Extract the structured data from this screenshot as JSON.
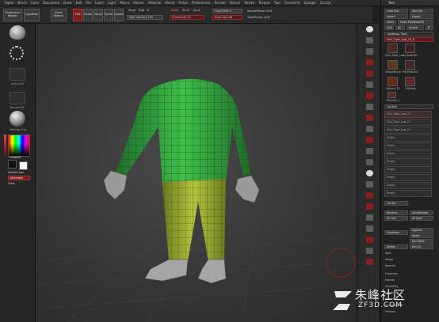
{
  "menu": [
    "Alpha",
    "Brush",
    "Color",
    "Document",
    "Draw",
    "Edit",
    "File",
    "Layer",
    "Light",
    "Macro",
    "Marker",
    "Material",
    "Movie",
    "Picker",
    "Preferences",
    "Render",
    "Stencil",
    "Stroke",
    "Texture",
    "Tool",
    "Transform",
    "Zplugin",
    "Zscript"
  ],
  "top": {
    "projection": "Projection Master",
    "lightbox": "LightBox",
    "quicksketch": "Quick Sketch",
    "edit": "Edit",
    "draw": "Draw",
    "move": "Move",
    "scale": "Scale",
    "rotate": "Rotate",
    "mrgb": "Mrgb",
    "rgb": "Rgb",
    "m": "M",
    "rgb_intensity": "Rgb Intensity 100",
    "zadd": "Zadd",
    "zsub": "Zsub",
    "zcut": "Zcut",
    "z_intensity": "Z Intensity 25",
    "focal_shift": "Focal Shift 0",
    "draw_size": "Draw Size 64",
    "active_points": "ActivePoints: 816",
    "total_points": "TotalPoints: 816"
  },
  "left": {
    "gradient": "Gradient",
    "switch_color": "SwitchColor",
    "alternate": "Alternate",
    "clear": "Clear",
    "labels": [
      "Alpha Off",
      "Texture Off",
      "MatCap Gray"
    ]
  },
  "tool": {
    "title": "Tool",
    "load": "Load Tool",
    "save": "Save As",
    "import": "Import",
    "export": "Export",
    "clone": "Clone",
    "make_poly": "Make PolyMesh3D",
    "goz": "GoZ",
    "all": "All",
    "visible": "Visible",
    "r": "R",
    "lightbox_tools": "Lightbox► Tools",
    "current_tool": "Simi_Tiger_Low_23_D",
    "thumbs": [
      {
        "label": "Simi_Tiger_Low"
      },
      {
        "label": "Cylinder3D"
      },
      {
        "label": "SimpleBrush"
      },
      {
        "label": "PolyMesh3D"
      },
      {
        "label": "Sphere_3D"
      },
      {
        "label": "ZSphere"
      },
      {
        "label": "ZSphere_1"
      }
    ],
    "subtool": "SubTool",
    "subtools": [
      "Simi_Tiger_Low_23",
      "Simi_Tiger_Low_23",
      "Simi_Tiger_Low_23"
    ],
    "empty_slot": "Empty",
    "list_all": "List All",
    "rename": "Rename",
    "auto_reorder": "AutoReorder",
    "all_low": "All Low",
    "all_high": "All High",
    "duplicate": "Duplicate",
    "append": "Append",
    "insert": "Insert",
    "del_other": "Del Other",
    "delete": "Delete",
    "del_all": "Del All",
    "split": "Split",
    "merge": "Merge",
    "remesh": "Remesh",
    "menu_items": [
      "Projection",
      "Extract",
      "Geometry",
      "Layers",
      "FiberMesh",
      "Geometry HD",
      "Preview"
    ]
  },
  "watermark": {
    "cn": "朱峰社区",
    "url": "ZF3D.COM"
  }
}
